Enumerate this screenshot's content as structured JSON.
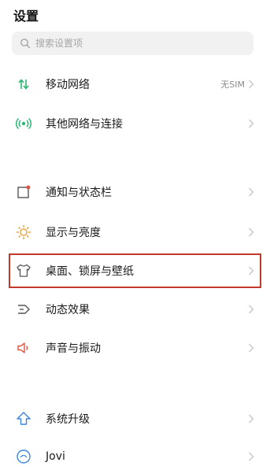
{
  "header": {
    "title": "设置"
  },
  "search": {
    "placeholder": "搜索设置项"
  },
  "rows": [
    {
      "label": "移动网络",
      "value": "无SIM",
      "icon": "mobile-network-icon"
    },
    {
      "label": "其他网络与连接",
      "icon": "other-connections-icon"
    },
    {
      "label": "通知与状态栏",
      "icon": "notification-icon"
    },
    {
      "label": "显示与亮度",
      "icon": "brightness-icon"
    },
    {
      "label": "桌面、锁屏与壁纸",
      "icon": "wallpaper-icon",
      "highlighted": true
    },
    {
      "label": "动态效果",
      "icon": "motion-effects-icon"
    },
    {
      "label": "声音与振动",
      "icon": "sound-icon"
    },
    {
      "label": "系统升级",
      "icon": "system-upgrade-icon"
    },
    {
      "label": "Jovi",
      "icon": "jovi-icon"
    }
  ],
  "colors": {
    "accent": "#2bb673",
    "highlight_border": "#c0392b",
    "search_bg": "#f1f1f1"
  }
}
